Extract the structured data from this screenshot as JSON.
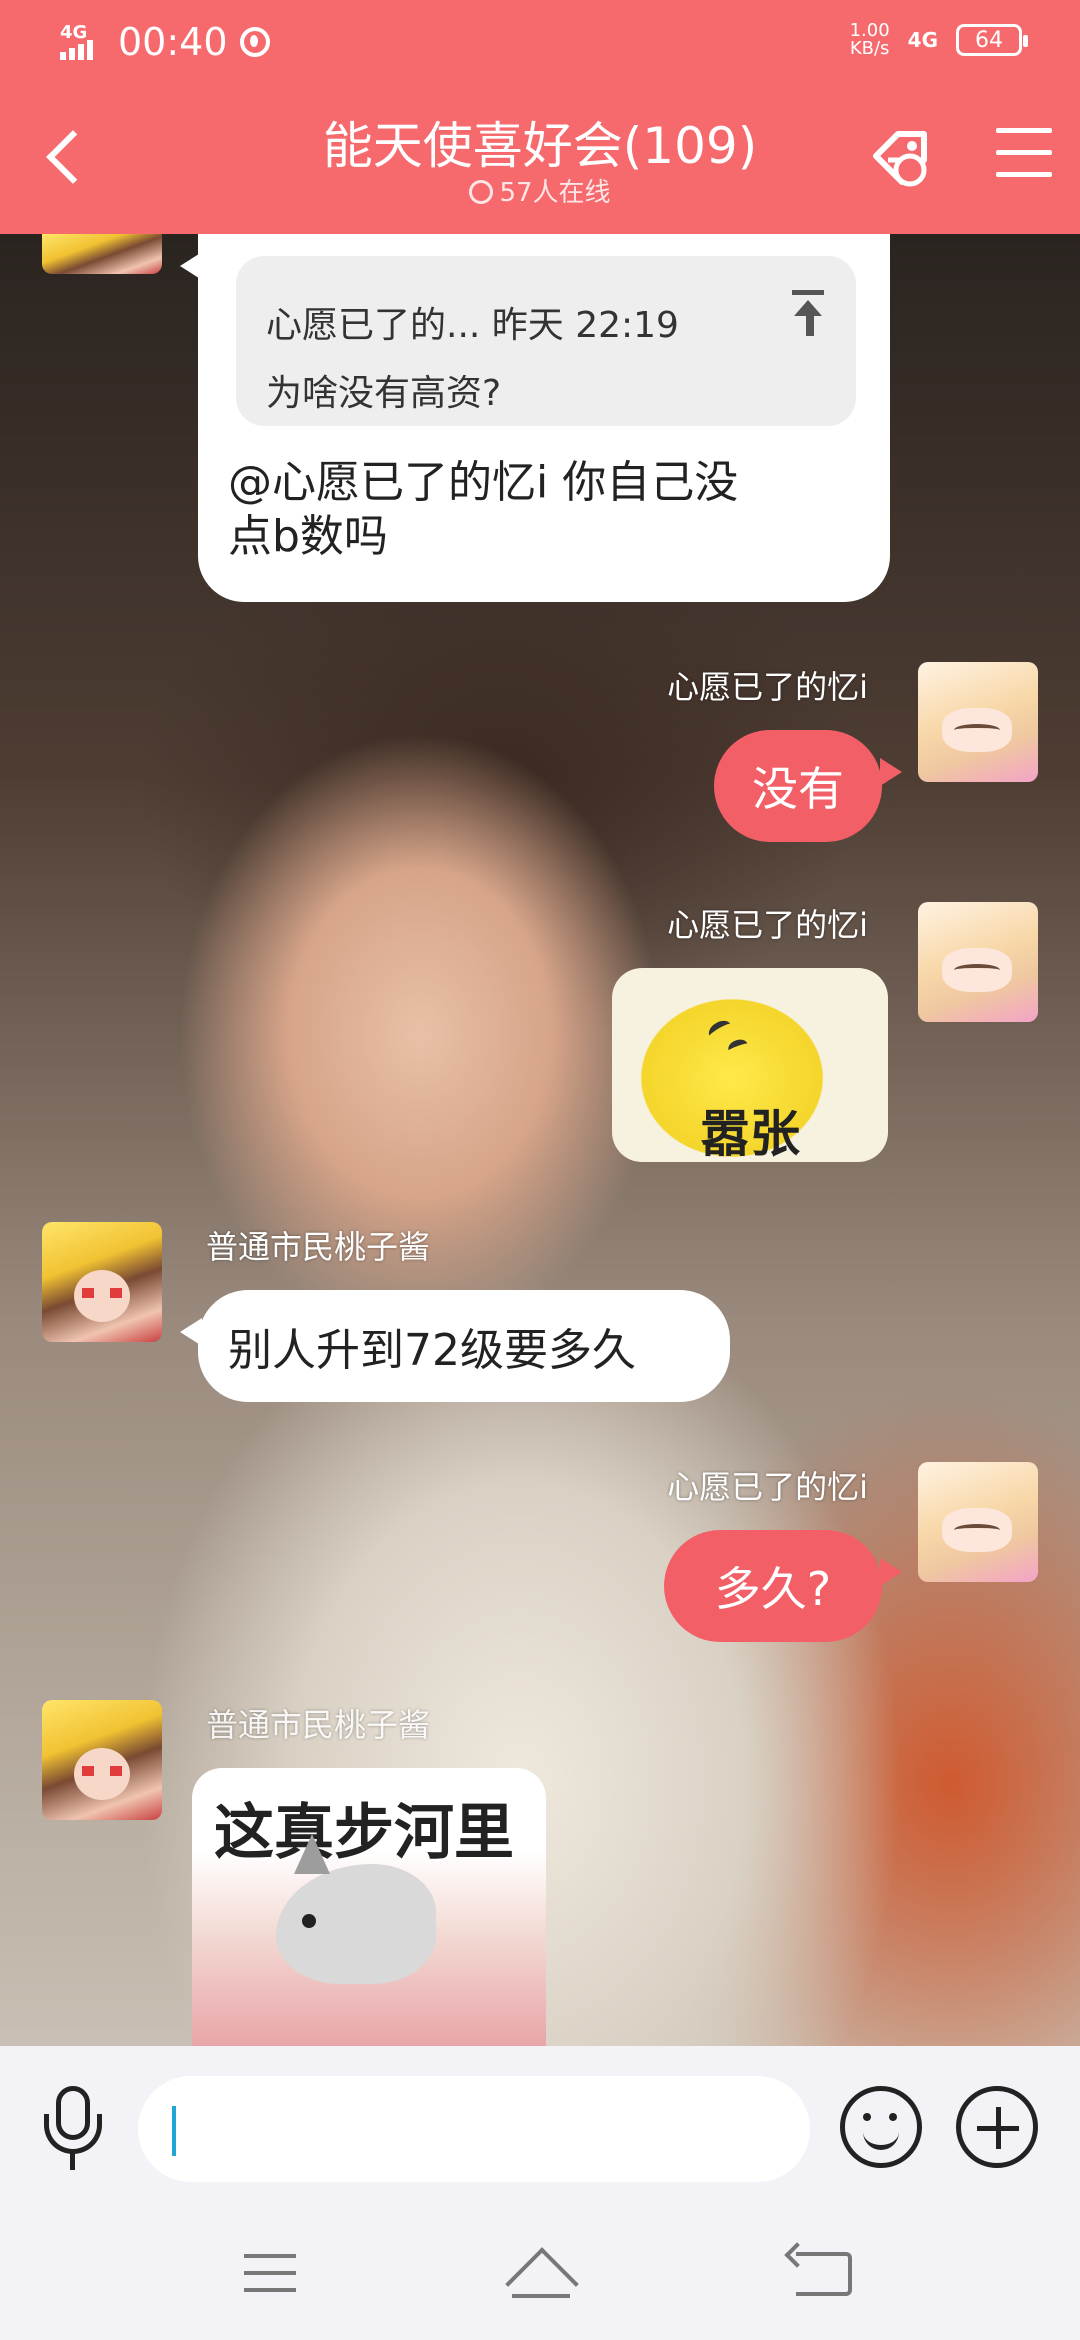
{
  "status_bar": {
    "network_left": "4G",
    "time": "00:40",
    "speed_value": "1.00",
    "speed_unit": "KB/s",
    "network_right": "4G",
    "battery": "64"
  },
  "header": {
    "title": "能天使喜好会(109)",
    "online": "57人在线"
  },
  "messages": {
    "quoted_reply": {
      "quote_line1": "心愿已了的... 昨天 22:19",
      "quote_line2": "为啥没有高资?",
      "text_line1": "@心愿已了的忆i 你自己没",
      "text_line2": "点b数吗"
    },
    "m1": {
      "sender": "心愿已了的忆i",
      "text": "没有"
    },
    "m2": {
      "sender": "心愿已了的忆i",
      "sticker_text": "嚣张"
    },
    "m3": {
      "sender": "普通市民桃子酱",
      "text": "别人升到72级要多久"
    },
    "m4": {
      "sender": "心愿已了的忆i",
      "text": "多久?"
    },
    "m5": {
      "sender": "普通市民桃子酱",
      "sticker_text": "这真步河里"
    }
  },
  "icons": {
    "mic": "microphone-icon",
    "emoji": "smiley-icon",
    "plus": "plus-circle-icon",
    "back": "chevron-left-icon",
    "menu": "hamburger-icon"
  },
  "colors": {
    "header": "#f66a6e",
    "bubble_self": "#f35f67",
    "bubble_other": "#ffffff"
  }
}
